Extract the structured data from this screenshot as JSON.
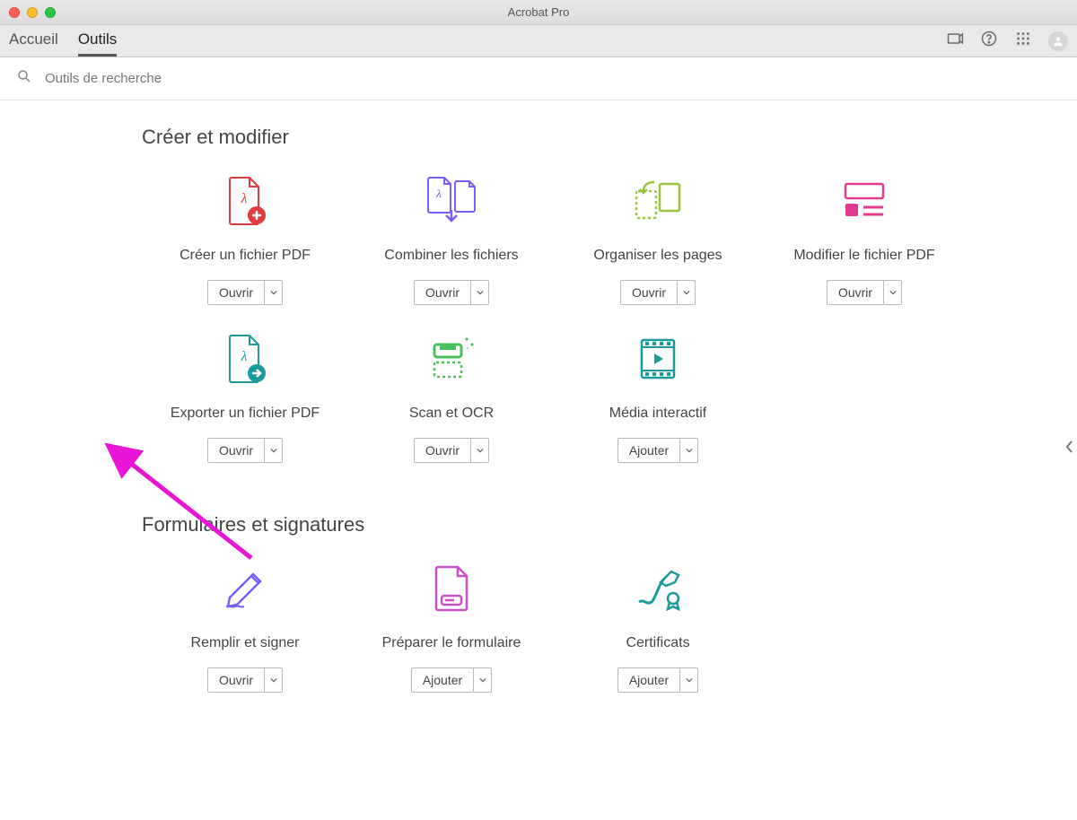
{
  "window": {
    "title": "Acrobat Pro"
  },
  "tabs": {
    "home": "Accueil",
    "tools": "Outils"
  },
  "search": {
    "placeholder": "Outils de recherche"
  },
  "sections": {
    "create_modify": {
      "title": "Créer et modifier",
      "tools": [
        {
          "label": "Créer un fichier PDF",
          "button": "Ouvrir"
        },
        {
          "label": "Combiner les fichiers",
          "button": "Ouvrir"
        },
        {
          "label": "Organiser les pages",
          "button": "Ouvrir"
        },
        {
          "label": "Modifier le fichier PDF",
          "button": "Ouvrir"
        },
        {
          "label": "Exporter un fichier PDF",
          "button": "Ouvrir"
        },
        {
          "label": "Scan et OCR",
          "button": "Ouvrir"
        },
        {
          "label": "Média interactif",
          "button": "Ajouter"
        }
      ]
    },
    "forms_signatures": {
      "title": "Formulaires et signatures",
      "tools": [
        {
          "label": "Remplir et signer",
          "button": "Ouvrir"
        },
        {
          "label": "Préparer le formulaire",
          "button": "Ajouter"
        },
        {
          "label": "Certificats",
          "button": "Ajouter"
        }
      ]
    }
  }
}
